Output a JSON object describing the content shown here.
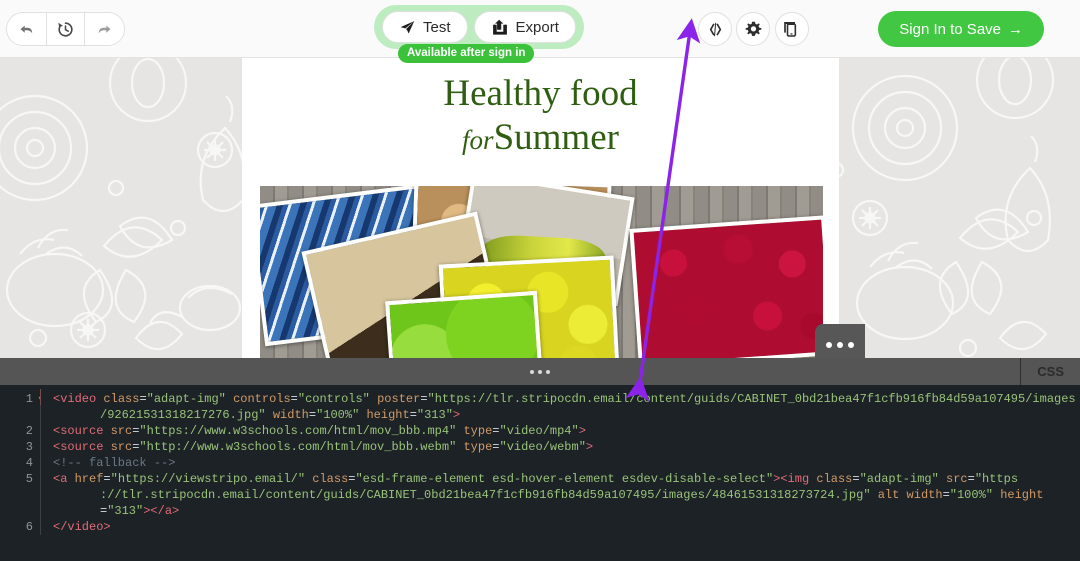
{
  "toolbar": {
    "undo_label": "Undo",
    "history_label": "Version history",
    "redo_label": "Redo",
    "test_label": "Test",
    "export_label": "Export",
    "available_badge": "Available after sign in",
    "code_label": "Code editor",
    "settings_label": "Settings",
    "device_label": "Device preview",
    "signin_label": "Sign In to Save",
    "signin_arrow": "→"
  },
  "canvas": {
    "title_line1": "Healthy food",
    "title_prefix": "for",
    "title_line2": "Summer",
    "title_color": "#2f5e12",
    "more_options_label": "More options"
  },
  "editor": {
    "tab_label": "CSS",
    "drag_handle_label": "Resize editor",
    "line_numbers": [
      "1",
      "2",
      "3",
      "4",
      "5",
      "6"
    ],
    "lines": [
      {
        "num": "1",
        "foldable": true,
        "segments": [
          {
            "t": "<video ",
            "c": "tag"
          },
          {
            "t": "class",
            "c": "attr"
          },
          {
            "t": "=",
            "c": "eq"
          },
          {
            "t": "\"adapt-img\"",
            "c": "val"
          },
          {
            "t": " ",
            "c": "plain"
          },
          {
            "t": "controls",
            "c": "attr"
          },
          {
            "t": "=",
            "c": "eq"
          },
          {
            "t": "\"controls\"",
            "c": "val"
          },
          {
            "t": " ",
            "c": "plain"
          },
          {
            "t": "poster",
            "c": "attr"
          },
          {
            "t": "=",
            "c": "eq"
          },
          {
            "t": "\"https://tlr.stripocdn.email/content/guids/CABINET_0bd21bea47f1cfb916fb84d59a107495/images",
            "c": "val"
          }
        ]
      },
      {
        "num": "",
        "continuation": true,
        "segments": [
          {
            "t": "/92621531318217276.jpg\"",
            "c": "val"
          },
          {
            "t": " ",
            "c": "plain"
          },
          {
            "t": "width",
            "c": "attr"
          },
          {
            "t": "=",
            "c": "eq"
          },
          {
            "t": "\"100%\"",
            "c": "val"
          },
          {
            "t": " ",
            "c": "plain"
          },
          {
            "t": "height",
            "c": "attr"
          },
          {
            "t": "=",
            "c": "eq"
          },
          {
            "t": "\"313\"",
            "c": "val"
          },
          {
            "t": ">",
            "c": "gt"
          }
        ]
      },
      {
        "num": "2",
        "segments": [
          {
            "t": "<source ",
            "c": "tag"
          },
          {
            "t": "src",
            "c": "attr"
          },
          {
            "t": "=",
            "c": "eq"
          },
          {
            "t": "\"https://www.w3schools.com/html/mov_bbb.mp4\"",
            "c": "val"
          },
          {
            "t": " ",
            "c": "plain"
          },
          {
            "t": "type",
            "c": "attr"
          },
          {
            "t": "=",
            "c": "eq"
          },
          {
            "t": "\"video/mp4\"",
            "c": "val"
          },
          {
            "t": ">",
            "c": "gt"
          }
        ]
      },
      {
        "num": "3",
        "segments": [
          {
            "t": "<source ",
            "c": "tag"
          },
          {
            "t": "src",
            "c": "attr"
          },
          {
            "t": "=",
            "c": "eq"
          },
          {
            "t": "\"http://www.w3schools.com/html/mov_bbb.webm\"",
            "c": "val"
          },
          {
            "t": " ",
            "c": "plain"
          },
          {
            "t": "type",
            "c": "attr"
          },
          {
            "t": "=",
            "c": "eq"
          },
          {
            "t": "\"video/webm\"",
            "c": "val"
          },
          {
            "t": ">",
            "c": "gt"
          }
        ]
      },
      {
        "num": "4",
        "segments": [
          {
            "t": "<!-- fallback -->",
            "c": "cmt"
          }
        ]
      },
      {
        "num": "5",
        "segments": [
          {
            "t": "<a ",
            "c": "tag"
          },
          {
            "t": "href",
            "c": "attr"
          },
          {
            "t": "=",
            "c": "eq"
          },
          {
            "t": "\"https://viewstripo.email/\"",
            "c": "val"
          },
          {
            "t": " ",
            "c": "plain"
          },
          {
            "t": "class",
            "c": "attr"
          },
          {
            "t": "=",
            "c": "eq"
          },
          {
            "t": "\"esd-frame-element esd-hover-element esdev-disable-select\"",
            "c": "val"
          },
          {
            "t": ">",
            "c": "gt"
          },
          {
            "t": "<img ",
            "c": "tag"
          },
          {
            "t": "class",
            "c": "attr"
          },
          {
            "t": "=",
            "c": "eq"
          },
          {
            "t": "\"adapt-img\"",
            "c": "val"
          },
          {
            "t": " ",
            "c": "plain"
          },
          {
            "t": "src",
            "c": "attr"
          },
          {
            "t": "=",
            "c": "eq"
          },
          {
            "t": "\"https",
            "c": "val"
          }
        ]
      },
      {
        "num": "",
        "continuation": true,
        "segments": [
          {
            "t": "://tlr.stripocdn.email/content/guids/CABINET_0bd21bea47f1cfb916fb84d59a107495/images/48461531318273724.jpg\"",
            "c": "val"
          },
          {
            "t": " ",
            "c": "plain"
          },
          {
            "t": "alt",
            "c": "attr"
          },
          {
            "t": " ",
            "c": "plain"
          },
          {
            "t": "width",
            "c": "attr"
          },
          {
            "t": "=",
            "c": "eq"
          },
          {
            "t": "\"100%\"",
            "c": "val"
          },
          {
            "t": " ",
            "c": "plain"
          },
          {
            "t": "height",
            "c": "attr"
          }
        ]
      },
      {
        "num": "",
        "continuation": true,
        "segments": [
          {
            "t": "=",
            "c": "eq"
          },
          {
            "t": "\"313\"",
            "c": "val"
          },
          {
            "t": ">",
            "c": "gt"
          },
          {
            "t": "</a>",
            "c": "tag"
          }
        ]
      },
      {
        "num": "6",
        "segments": [
          {
            "t": "</video>",
            "c": "tag"
          }
        ]
      }
    ]
  },
  "annotation": {
    "arrow_color": "#8b23e8",
    "label": "double-headed-arrow pointing at code editor button"
  }
}
